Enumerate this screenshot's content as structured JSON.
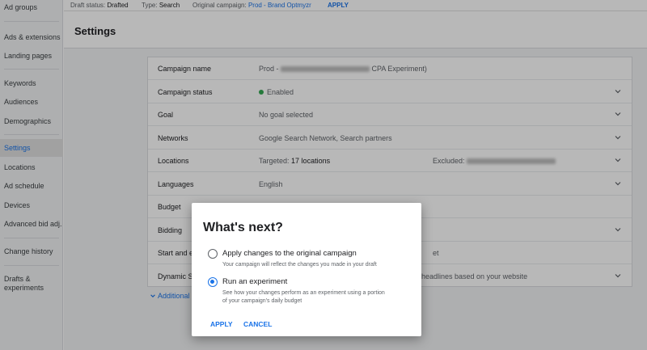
{
  "sidebar": {
    "items": [
      {
        "label": "Ad groups"
      },
      {
        "label": "Ads & extensions"
      },
      {
        "label": "Landing pages"
      },
      {
        "label": "Keywords"
      },
      {
        "label": "Audiences"
      },
      {
        "label": "Demographics"
      },
      {
        "label": "Settings"
      },
      {
        "label": "Locations"
      },
      {
        "label": "Ad schedule"
      },
      {
        "label": "Devices"
      },
      {
        "label": "Advanced bid adj."
      },
      {
        "label": "Change history"
      },
      {
        "label": "Drafts & experiments"
      }
    ],
    "active": "Settings"
  },
  "topbar": {
    "draft_label": "Draft status:",
    "draft_value": "Drafted",
    "type_label": "Type:",
    "type_value": "Search",
    "orig_label": "Original campaign:",
    "orig_value": "Prod - Brand Optmyzr",
    "apply": "APPLY"
  },
  "header": {
    "title": "Settings"
  },
  "settings": {
    "campaign_name": {
      "label": "Campaign name",
      "value_prefix": "Prod -",
      "value_suffix": "CPA Experiment)"
    },
    "campaign_status": {
      "label": "Campaign status",
      "value": "Enabled"
    },
    "goal": {
      "label": "Goal",
      "value": "No goal selected"
    },
    "networks": {
      "label": "Networks",
      "value": "Google Search Network, Search partners"
    },
    "locations": {
      "label": "Locations",
      "targeted_label": "Targeted:",
      "targeted_value": "17 locations",
      "excluded_label": "Excluded:"
    },
    "languages": {
      "label": "Languages",
      "value": "English"
    },
    "budget": {
      "label": "Budget"
    },
    "bidding": {
      "label": "Bidding"
    },
    "start_end": {
      "label": "Start and e",
      "value_tail": "et"
    },
    "dynamic": {
      "label": "Dynamic S",
      "value_tail": "headlines based on your website"
    },
    "additional": "Additional s"
  },
  "dialog": {
    "title": "What's next?",
    "options": [
      {
        "label": "Apply changes to the original campaign",
        "desc": "Your campaign will reflect the changes you made in your draft",
        "checked": false
      },
      {
        "label": "Run an experiment",
        "desc": "See how your changes perform as an experiment using a portion of your campaign's daily budget",
        "checked": true
      }
    ],
    "apply": "APPLY",
    "cancel": "CANCEL"
  },
  "colors": {
    "accent": "#1a73e8",
    "status_enabled": "#34a853"
  }
}
